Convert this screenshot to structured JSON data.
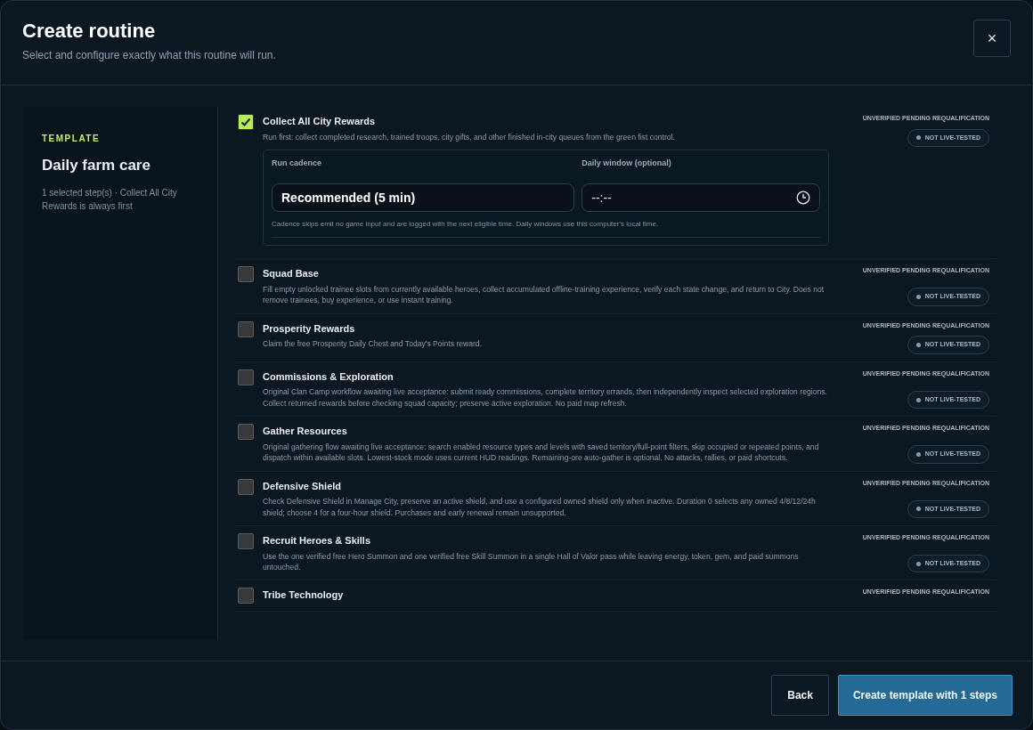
{
  "title": "Create routine",
  "subtitle": "Select and configure exactly what this routine will run.",
  "close": "×",
  "template": {
    "eyebrow": "TEMPLATE",
    "name": "Daily farm care",
    "summary": "1 selected step(s) · Collect All City Rewards is always first"
  },
  "steps": [
    {
      "title": "Collect All City Rewards",
      "checked": true,
      "description": "Run first: collect completed research, trained troops, city gifts, and other finished in-city queues from the green fist control.",
      "status": "UNVERIFIED PENDING REQUALIFICATION",
      "badge": "NOT LIVE-TESTED",
      "config": {
        "cadence_label": "Run cadence",
        "cadence_value": "Recommended (5 min)",
        "window_label": "Daily window (optional)",
        "window_value": "--:--",
        "note": "Cadence skips emit no game input and are logged with the next eligible time. Daily windows use this computer's local time."
      }
    },
    {
      "title": "Squad Base",
      "checked": false,
      "description": "Fill empty unlocked trainee slots from currently available heroes, collect accumulated offline-training experience, verify each state change, and return to City. Does not remove trainees, buy experience, or use instant training.",
      "status": "UNVERIFIED PENDING REQUALIFICATION",
      "badge": "NOT LIVE-TESTED"
    },
    {
      "title": "Prosperity Rewards",
      "checked": false,
      "description": "Claim the free Prosperity Daily Chest and Today's Points reward.",
      "status": "UNVERIFIED PENDING REQUALIFICATION",
      "badge": "NOT LIVE-TESTED"
    },
    {
      "title": "Commissions & Exploration",
      "checked": false,
      "description": "Original Clan Camp workflow awaiting live acceptance: submit ready commissions, complete territory errands, then independently inspect selected exploration regions. Collect returned rewards before checking squad capacity; preserve active exploration. No paid map refresh.",
      "status": "UNVERIFIED PENDING REQUALIFICATION",
      "badge": "NOT LIVE-TESTED"
    },
    {
      "title": "Gather Resources",
      "checked": false,
      "description": "Original gathering flow awaiting live acceptance: search enabled resource types and levels with saved territory/full-point filters, skip occupied or repeated points, and dispatch within available slots. Lowest-stock mode uses current HUD readings. Remaining-ore auto-gather is optional. No attacks, rallies, or paid shortcuts.",
      "status": "UNVERIFIED PENDING REQUALIFICATION",
      "badge": "NOT LIVE-TESTED"
    },
    {
      "title": "Defensive Shield",
      "checked": false,
      "description": "Check Defensive Shield in Manage City, preserve an active shield, and use a configured owned shield only when inactive. Duration 0 selects any owned 4/8/12/24h shield; choose 4 for a four-hour shield. Purchases and early renewal remain unsupported.",
      "status": "UNVERIFIED PENDING REQUALIFICATION",
      "badge": "NOT LIVE-TESTED"
    },
    {
      "title": "Recruit Heroes & Skills",
      "checked": false,
      "description": "Use the one verified free Hero Summon and one verified free Skill Summon in a single Hall of Valor pass while leaving energy, token, gem, and paid summons untouched.",
      "status": "UNVERIFIED PENDING REQUALIFICATION",
      "badge": "NOT LIVE-TESTED"
    },
    {
      "title": "Tribe Technology",
      "checked": false,
      "status": "UNVERIFIED PENDING REQUALIFICATION"
    }
  ],
  "buttons": [
    {
      "label": "Back",
      "kind": "secondary"
    },
    {
      "label": "Create template with 1 steps",
      "kind": "primary"
    }
  ]
}
